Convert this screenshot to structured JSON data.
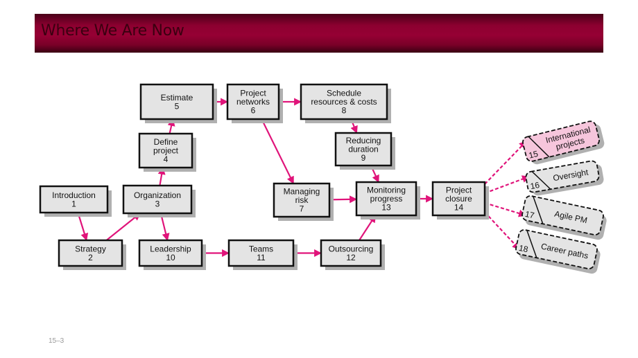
{
  "header": {
    "title": "Where We Are Now"
  },
  "footer": {
    "slide_number": "15–3"
  },
  "colors": {
    "banner": "#8c0030",
    "arrow": "#e0147a",
    "box_fill": "#e4e4e4",
    "box_shadow": "#b0b0b0",
    "highlight_fill": "#f6c6dc"
  },
  "nodes": [
    {
      "id": 1,
      "lines": [
        "Introduction",
        "1"
      ]
    },
    {
      "id": 2,
      "lines": [
        "Strategy",
        "2"
      ]
    },
    {
      "id": 3,
      "lines": [
        "Organization",
        "3"
      ]
    },
    {
      "id": 4,
      "lines": [
        "Define",
        "project",
        "4"
      ]
    },
    {
      "id": 5,
      "lines": [
        "Estimate",
        "5"
      ]
    },
    {
      "id": 6,
      "lines": [
        "Project",
        "networks",
        "6"
      ]
    },
    {
      "id": 7,
      "lines": [
        "Managing",
        "risk",
        "7"
      ]
    },
    {
      "id": 8,
      "lines": [
        "Schedule",
        "resources & costs",
        "8"
      ]
    },
    {
      "id": 9,
      "lines": [
        "Reducing",
        "duration",
        "9"
      ]
    },
    {
      "id": 10,
      "lines": [
        "Leadership",
        "10"
      ]
    },
    {
      "id": 11,
      "lines": [
        "Teams",
        "11"
      ]
    },
    {
      "id": 12,
      "lines": [
        "Outsourcing",
        "12"
      ]
    },
    {
      "id": 13,
      "lines": [
        "Monitoring",
        "progress",
        "13"
      ]
    },
    {
      "id": 14,
      "lines": [
        "Project",
        "closure",
        "14"
      ]
    }
  ],
  "optional_nodes": [
    {
      "id": 15,
      "number": "15",
      "lines": [
        "International",
        "projects"
      ],
      "highlighted": true
    },
    {
      "id": 16,
      "number": "16",
      "lines": [
        "Oversight"
      ],
      "highlighted": false
    },
    {
      "id": 17,
      "number": "17",
      "lines": [
        "Agile PM"
      ],
      "highlighted": false
    },
    {
      "id": 18,
      "number": "18",
      "lines": [
        "Career paths"
      ],
      "highlighted": false
    }
  ],
  "edges": [
    [
      1,
      2
    ],
    [
      2,
      3
    ],
    [
      3,
      4
    ],
    [
      4,
      5
    ],
    [
      5,
      6
    ],
    [
      6,
      8
    ],
    [
      8,
      9
    ],
    [
      6,
      7
    ],
    [
      9,
      13
    ],
    [
      7,
      13
    ],
    [
      3,
      10
    ],
    [
      10,
      11
    ],
    [
      11,
      12
    ],
    [
      12,
      13
    ],
    [
      13,
      14
    ]
  ],
  "dashed_edges": [
    [
      14,
      15
    ],
    [
      14,
      16
    ],
    [
      14,
      17
    ],
    [
      14,
      18
    ]
  ]
}
